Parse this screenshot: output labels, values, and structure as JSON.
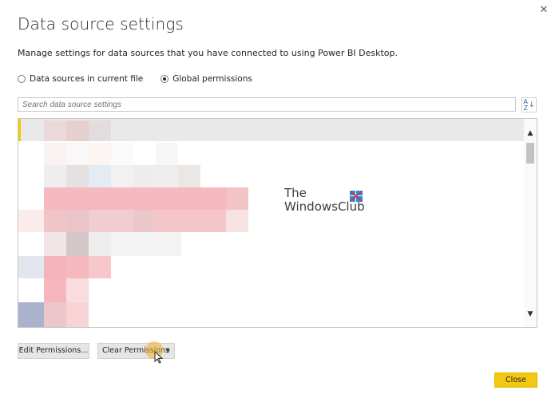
{
  "dialog": {
    "title": "Data source settings",
    "description": "Manage settings for data sources that you have connected to using Power BI Desktop.",
    "close_glyph": "✕"
  },
  "scope": {
    "options": [
      {
        "label": "Data sources in current file",
        "selected": false
      },
      {
        "label": "Global permissions",
        "selected": true
      }
    ]
  },
  "search": {
    "placeholder": "Search data source settings"
  },
  "sort": {
    "top": "A",
    "bottom": "Z"
  },
  "watermark": {
    "line1": "The",
    "line2": "WindowsClub"
  },
  "buttons": {
    "edit_permissions": "Edit Permissions...",
    "clear_permissions": "Clear Permissions",
    "close": "Close"
  },
  "colors": {
    "accent": "#f2c811",
    "selected_row": "#e9e9e9",
    "text": "#252423"
  }
}
